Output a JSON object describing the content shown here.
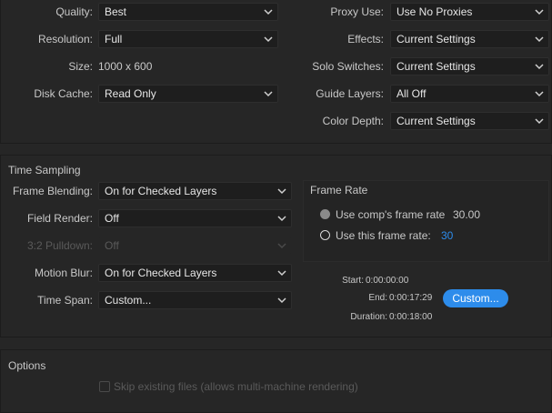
{
  "render": {
    "quality": {
      "label": "Quality:",
      "value": "Best"
    },
    "resolution": {
      "label": "Resolution:",
      "value": "Full"
    },
    "size": {
      "label": "Size:",
      "value": "1000 x 600"
    },
    "disk_cache": {
      "label": "Disk Cache:",
      "value": "Read Only"
    },
    "proxy_use": {
      "label": "Proxy Use:",
      "value": "Use No Proxies"
    },
    "effects": {
      "label": "Effects:",
      "value": "Current Settings"
    },
    "solo_switches": {
      "label": "Solo Switches:",
      "value": "Current Settings"
    },
    "guide_layers": {
      "label": "Guide Layers:",
      "value": "All Off"
    },
    "color_depth": {
      "label": "Color Depth:",
      "value": "Current Settings"
    }
  },
  "time_sampling": {
    "title": "Time Sampling",
    "frame_blending": {
      "label": "Frame Blending:",
      "value": "On for Checked Layers"
    },
    "field_render": {
      "label": "Field Render:",
      "value": "Off"
    },
    "pulldown": {
      "label": "3:2 Pulldown:",
      "value": "Off"
    },
    "motion_blur": {
      "label": "Motion Blur:",
      "value": "On for Checked Layers"
    },
    "time_span": {
      "label": "Time Span:",
      "value": "Custom..."
    }
  },
  "frame_rate": {
    "title": "Frame Rate",
    "comp_rate_label": "Use comp's frame rate",
    "comp_rate_value": "30.00",
    "this_rate_label": "Use this frame rate:",
    "this_rate_value": "30"
  },
  "span_info": {
    "start_label": "Start:",
    "start_value": "0:00:00:00",
    "end_label": "End:",
    "end_value": "0:00:17:29",
    "duration_label": "Duration:",
    "duration_value": "0:00:18:00",
    "custom_button": "Custom..."
  },
  "options": {
    "title": "Options",
    "skip_label": "Skip existing files (allows multi-machine rendering)"
  },
  "colors": {
    "accent": "#2d8ceb",
    "background": "#262626",
    "field": "#1e1e1e"
  }
}
